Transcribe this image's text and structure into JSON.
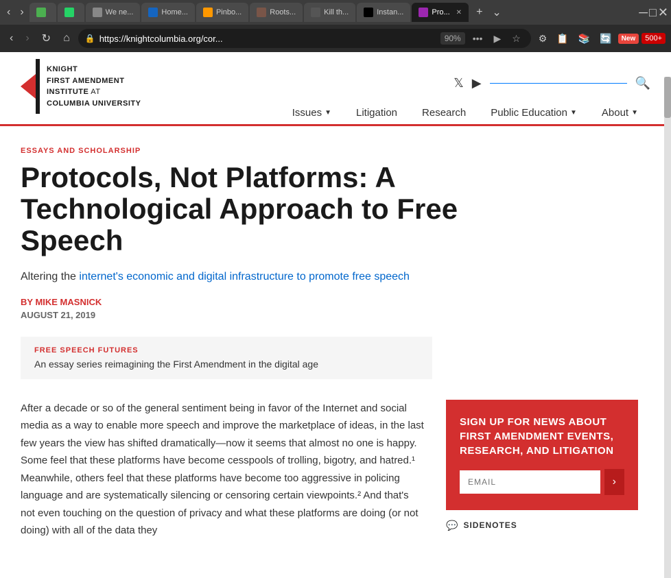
{
  "browser": {
    "tabs": [
      {
        "id": 1,
        "label": "We ne...",
        "favicon_color": "#4CAF50",
        "active": false
      },
      {
        "id": 2,
        "label": "Home...",
        "favicon_color": "#1565C0",
        "active": false
      },
      {
        "id": 3,
        "label": "Pinbo...",
        "favicon_color": "#FF9800",
        "active": false
      },
      {
        "id": 4,
        "label": "Roots...",
        "favicon_color": "#5D4037",
        "active": false
      },
      {
        "id": 5,
        "label": "Kill th...",
        "favicon_color": "#666",
        "active": false
      },
      {
        "id": 6,
        "label": "Instan...",
        "favicon_color": "#000",
        "active": false
      },
      {
        "id": 7,
        "label": "Pro...",
        "favicon_color": "#9C27B0",
        "active": true
      }
    ],
    "url": "https://knightcolumbia.org/cor...",
    "zoom": "90%",
    "new_badge": "New",
    "new_badge_500": "500+"
  },
  "site": {
    "logo": {
      "line1": "KNIGHT",
      "line2": "FIRST AMENDMENT",
      "line3": "INSTITUTE",
      "line3b": " at",
      "line4": "COLUMBIA UNIVERSITY"
    },
    "nav": {
      "items": [
        {
          "label": "Issues",
          "has_dropdown": true
        },
        {
          "label": "Litigation",
          "has_dropdown": false
        },
        {
          "label": "Research",
          "has_dropdown": false
        },
        {
          "label": "Public Education",
          "has_dropdown": true
        },
        {
          "label": "About",
          "has_dropdown": true
        }
      ]
    },
    "article": {
      "section_tag": "ESSAYS AND SCHOLARSHIP",
      "title": "Protocols, Not Platforms: A Technological Approach to Free Speech",
      "subtitle": "Altering the internet's economic and digital infrastructure to promote free speech",
      "author_prefix": "BY ",
      "author": "MIKE MASNICK",
      "date": "AUGUST 21, 2019",
      "series_tag": "FREE SPEECH FUTURES",
      "series_desc": "An essay series reimagining the First Amendment in the digital age",
      "body_text": "After a decade or so of the general sentiment being in favor of the Internet and social media as a way to enable more speech and improve the marketplace of ideas, in the last few years the view has shifted dramatically—now it seems that almost no one is happy. Some feel that these platforms have become cesspools of trolling, bigotry, and hatred.¹ Meanwhile, others feel that these platforms have become too aggressive in policing language and are systematically silencing or censoring certain viewpoints.² And that's not even touching on the question of privacy and what these platforms are doing (or not doing) with all of the data they"
    },
    "signup": {
      "title": "SIGN UP FOR NEWS ABOUT FIRST AMENDMENT EVENTS, RESEARCH, AND LITIGATION",
      "email_placeholder": "EMAIL",
      "submit_label": "›"
    },
    "sidenotes_label": "SIDENOTES"
  }
}
